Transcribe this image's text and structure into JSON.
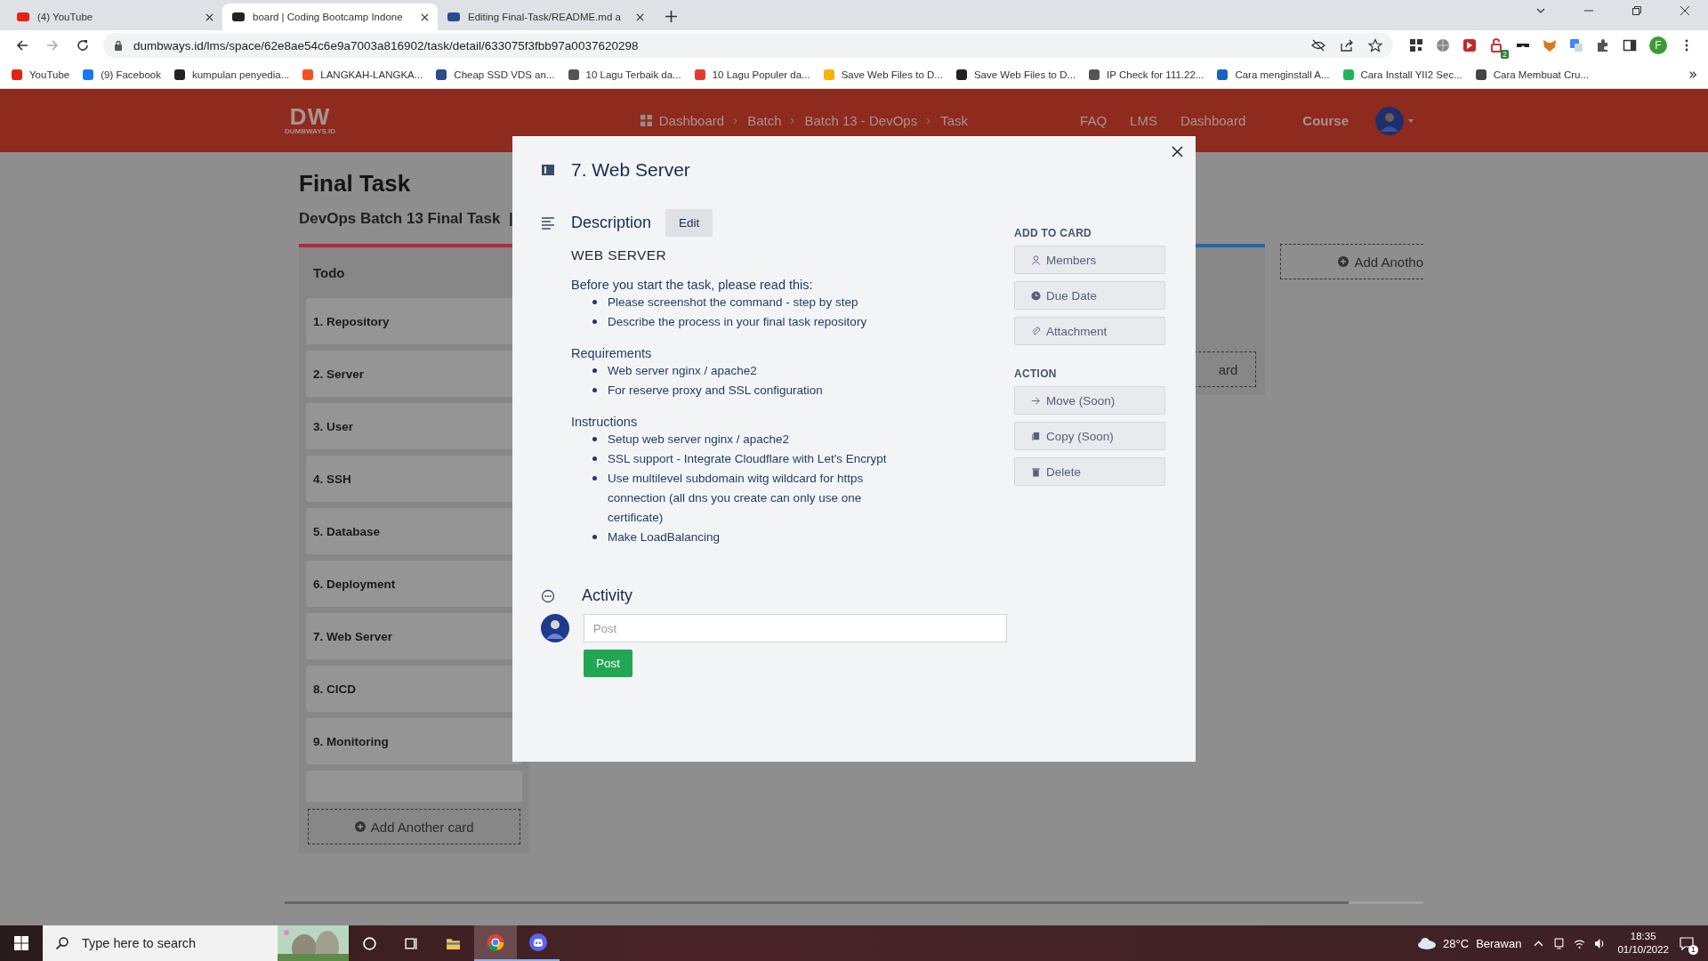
{
  "browser": {
    "tabs": [
      {
        "title": "(4) YouTube",
        "selected": false
      },
      {
        "title": "board | Coding Bootcamp Indone",
        "selected": true
      },
      {
        "title": "Editing Final-Task/README.md a",
        "selected": false
      }
    ],
    "url": "dumbways.id/lms/space/62e8ae54c6e9a7003a816902/task/detail/633075f3fbb97a0037620298",
    "extension_badge": "2",
    "profile_initial": "F",
    "bookmarks": [
      "YouTube",
      "(9) Facebook",
      "kumpulan penyedia...",
      "LANGKAH-LANGKA...",
      "Cheap SSD VDS an...",
      "10 Lagu Terbaik da...",
      "10 Lagu Populer da...",
      "Save Web Files to D...",
      "Save Web Files to D...",
      "IP Check for 111.22...",
      "Cara menginstall A...",
      "Cara Install YII2 Sec...",
      "Cara Membuat Cru..."
    ]
  },
  "site_header": {
    "logo": "DW",
    "logo_caption": "DUMBWAYS.ID",
    "breadcrumb": [
      "Dashboard",
      "Batch",
      "Batch 13 - DevOps",
      "Task"
    ],
    "nav": [
      "FAQ",
      "LMS",
      "Dashboard"
    ],
    "course": "Course"
  },
  "board": {
    "title": "Final Task",
    "subtitle": "DevOps Batch 13 Final Task  |",
    "columns": [
      {
        "kind": "full",
        "title": "Todo",
        "color": "#b02a3a",
        "cards": [
          "1. Repository",
          "2. Server",
          "3. User",
          "4. SSH",
          "5. Database",
          "6. Deployment",
          "7. Web Server",
          "8. CICD",
          "9. Monitoring"
        ],
        "add_button": "Add Another card"
      },
      {
        "kind": "partial",
        "color": "#2a64a8",
        "add_button": "ard"
      }
    ],
    "add_list_button": "Add Anotho"
  },
  "modal": {
    "title": "7. Web Server",
    "description_label": "Description",
    "edit_button": "Edit",
    "heading": "WEB SERVER",
    "sections": [
      {
        "title": "Before you start the task, please read this:",
        "items": [
          "Please screenshot the command - step by step",
          "Describe the process in your final task repository"
        ]
      },
      {
        "title": "Requirements",
        "items": [
          "Web server nginx / apache2",
          "For reserve proxy and SSL configuration"
        ]
      },
      {
        "title": "Instructions",
        "items": [
          "Setup web server nginx / apache2",
          "SSL support - Integrate Cloudflare with Let's Encrypt",
          "Use multilevel subdomain witg wildcard for https connection (all dns you create can only use one certificate)",
          "Make LoadBalancing"
        ]
      }
    ],
    "add_to_card": {
      "label": "ADD TO CARD",
      "buttons": [
        "Members",
        "Due Date",
        "Attachment"
      ]
    },
    "action": {
      "label": "ACTION",
      "buttons": [
        "Move (Soon)",
        "Copy (Soon)",
        "Delete"
      ]
    },
    "activity_label": "Activity",
    "post_placeholder": "Post",
    "post_button": "Post"
  },
  "taskbar": {
    "search_placeholder": "Type here to search",
    "temperature": "28°C",
    "weather": "Berawan",
    "time": "18:35",
    "date": "01/10/2022",
    "notification_count": "1"
  }
}
